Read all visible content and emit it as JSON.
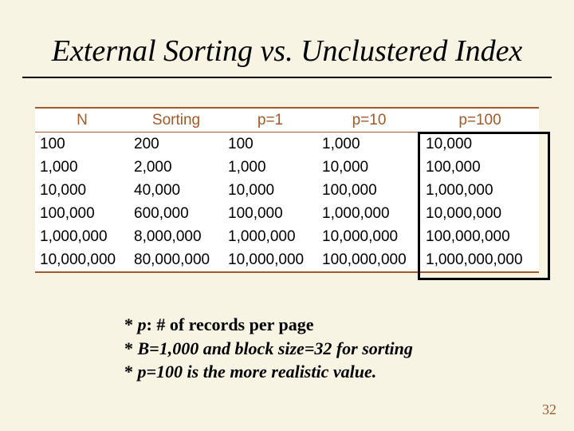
{
  "title": "External Sorting vs. Unclustered Index",
  "headers": [
    "N",
    "Sorting",
    "p=1",
    "p=10",
    "p=100"
  ],
  "rows": [
    [
      "100",
      "200",
      "100",
      "1,000",
      "10,000"
    ],
    [
      "1,000",
      "2,000",
      "1,000",
      "10,000",
      "100,000"
    ],
    [
      "10,000",
      "40,000",
      "10,000",
      "100,000",
      "1,000,000"
    ],
    [
      "100,000",
      "600,000",
      "100,000",
      "1,000,000",
      "10,000,000"
    ],
    [
      "1,000,000",
      "8,000,000",
      "1,000,000",
      "10,000,000",
      "100,000,000"
    ],
    [
      "10,000,000",
      "80,000,000",
      "10,000,000",
      "100,000,000",
      "1,000,000,000"
    ]
  ],
  "notes": {
    "star": "*",
    "line1_pre": "p",
    "line1_post": ": # of records per page",
    "line2": "B=1,000 and block size=32 for sorting",
    "line3": "p=100 is the more realistic value."
  },
  "page_number": "32",
  "chart_data": {
    "type": "table",
    "title": "External Sorting vs. Unclustered Index",
    "columns": [
      "N",
      "Sorting",
      "p=1",
      "p=10",
      "p=100"
    ],
    "data": [
      {
        "N": 100,
        "Sorting": 200,
        "p=1": 100,
        "p=10": 1000,
        "p=100": 10000
      },
      {
        "N": 1000,
        "Sorting": 2000,
        "p=1": 1000,
        "p=10": 10000,
        "p=100": 100000
      },
      {
        "N": 10000,
        "Sorting": 40000,
        "p=1": 10000,
        "p=10": 100000,
        "p=100": 1000000
      },
      {
        "N": 100000,
        "Sorting": 600000,
        "p=1": 100000,
        "p=10": 1000000,
        "p=100": 10000000
      },
      {
        "N": 1000000,
        "Sorting": 8000000,
        "p=1": 1000000,
        "p=10": 10000000,
        "p=100": 100000000
      },
      {
        "N": 10000000,
        "Sorting": 80000000,
        "p=1": 10000000,
        "p=10": 100000000,
        "p=100": 1000000000
      }
    ],
    "highlighted_column": "p=100",
    "notes": [
      "p: # of records per page",
      "B=1,000 and block size=32 for sorting",
      "p=100 is the more realistic value."
    ]
  }
}
